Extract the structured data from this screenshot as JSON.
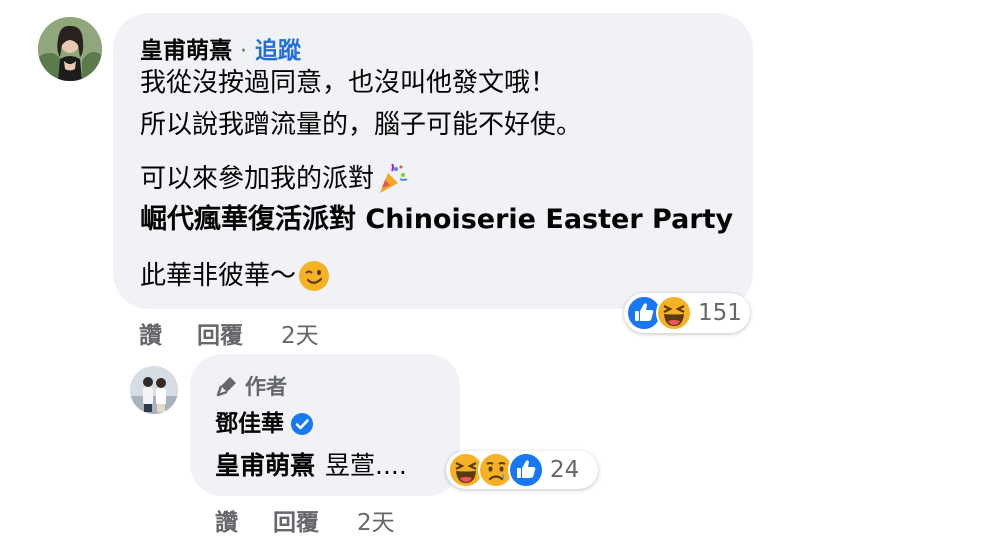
{
  "comment": {
    "author": "皇甫萌熹",
    "separator": "·",
    "follow_label": "追蹤",
    "lines": [
      "我從沒按過同意，也沒叫他發文哦！",
      "所以說我蹭流量的，腦子可能不好使。"
    ],
    "invite_line": "可以來參加我的派對",
    "event_name": "崛代瘋華復活派對 Chinoiserie Easter Party",
    "closing_line": "此華非彼華～",
    "reaction_count": "151",
    "actions": {
      "like": "讚",
      "reply": "回覆",
      "time": "2天"
    },
    "icons": [
      "avatar",
      "party-popper-icon",
      "wink-emoji-icon",
      "like-reaction-icon",
      "haha-reaction-icon"
    ]
  },
  "reply": {
    "author_badge": "作者",
    "author": "鄧佳華",
    "mention": "皇甫萌熹",
    "text": "昱萱....",
    "reaction_count": "24",
    "actions": {
      "like": "讚",
      "reply": "回覆",
      "time": "2天"
    },
    "icons": [
      "avatar",
      "microphone-icon",
      "verified-badge-icon",
      "haha-reaction-icon",
      "sad-reaction-icon",
      "like-reaction-icon"
    ]
  },
  "colors": {
    "bubble": "#f0f2f5",
    "link_blue": "#216fdb",
    "secondary_text": "#65676b",
    "like_blue": "#1877f2",
    "haha_yellow": "#f7b125"
  }
}
